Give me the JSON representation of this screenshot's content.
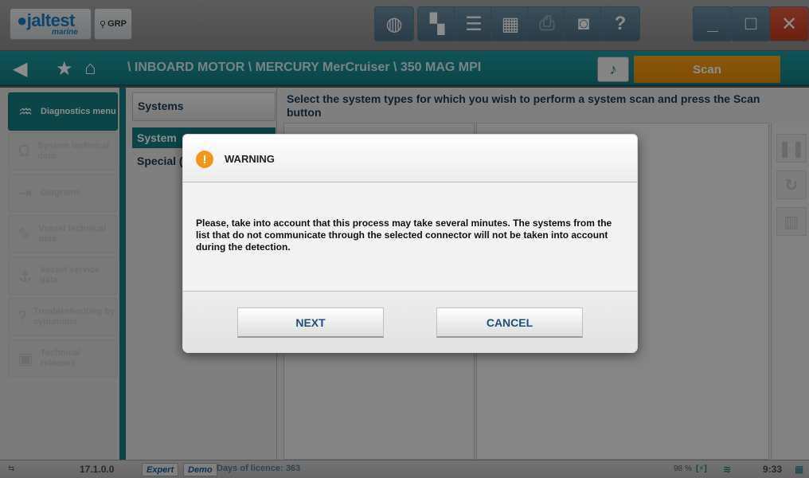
{
  "app": {
    "logo_text": "jaltest",
    "logo_sub": "marine",
    "grp_label": "GRP"
  },
  "toolbar": {
    "icons": [
      "globe-icon",
      "document-eye-icon",
      "list-icon",
      "keyboard-icon",
      "print-icon",
      "camera-icon",
      "help-icon",
      "minimize-icon",
      "maximize-icon",
      "close-icon"
    ]
  },
  "nav": {
    "breadcrumb": "\\ INBOARD MOTOR \\ MERCURY MerCruiser \\ 350 MAG MPI",
    "scan_label": "Scan"
  },
  "sidebar": {
    "items": [
      {
        "label": "Diagnostics menu",
        "active": true,
        "icon": "diagnostics-icon"
      },
      {
        "label": "System technical data",
        "active": false,
        "icon": "omega-icon"
      },
      {
        "label": "Diagrams",
        "active": false,
        "icon": "diagram-icon"
      },
      {
        "label": "Vessel technical data",
        "active": false,
        "icon": "wrench-icon"
      },
      {
        "label": "Vessel service data",
        "active": false,
        "icon": "service-icon"
      },
      {
        "label": "Troubleshooting by symptoms",
        "active": false,
        "icon": "troubleshoot-icon"
      },
      {
        "label": "Technical releases",
        "active": false,
        "icon": "releases-icon"
      }
    ]
  },
  "systems_panel": {
    "header": "Systems",
    "active_item": "System",
    "item2": "Special (shortcu"
  },
  "main": {
    "instructions": "Select the system types for which you wish to perform a system scan and press the Scan button"
  },
  "statusbar": {
    "version": "17.1.0.0",
    "mode_expert": "Expert",
    "mode_demo": "Demo",
    "licence": "Days of licence: 363",
    "battery": "98 %",
    "time": "9:33"
  },
  "dialog": {
    "title": "WARNING",
    "message": "Please, take into account that this process may take several minutes. The systems from the list that do not communicate through the selected connector will not be taken into account during the detection.",
    "next_label": "NEXT",
    "cancel_label": "CANCEL"
  }
}
